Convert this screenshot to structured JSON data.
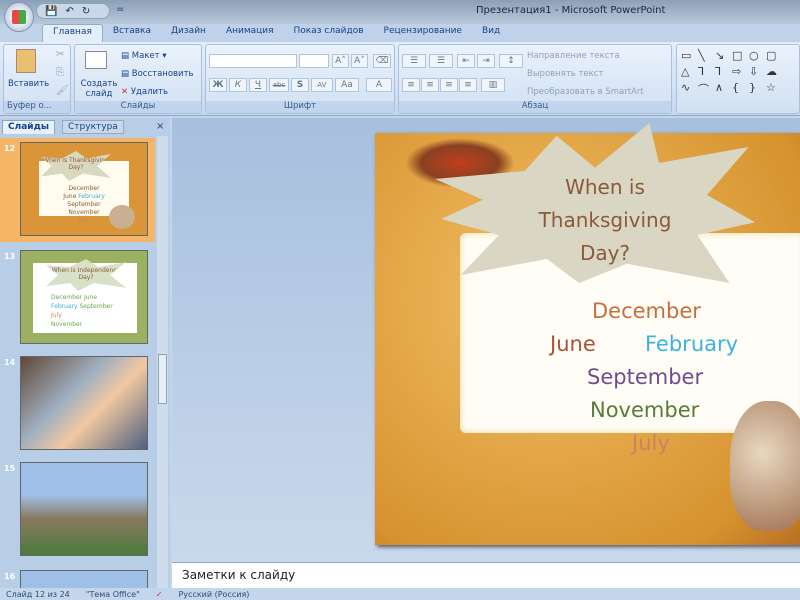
{
  "window": {
    "title": "Презентация1 - Microsoft PowerPoint"
  },
  "qat": {
    "save": "💾",
    "undo": "↶",
    "redo": "↻",
    "more": "="
  },
  "tabs": [
    "Главная",
    "Вставка",
    "Дизайн",
    "Анимация",
    "Показ слайдов",
    "Рецензирование",
    "Вид"
  ],
  "ribbon": {
    "clipboard": {
      "paste": "Вставить",
      "label": "Буфер о..."
    },
    "slides": {
      "new_slide": "Создать слайд",
      "layout": "Макет",
      "reset": "Восстановить",
      "delete": "Удалить",
      "label": "Слайды"
    },
    "font": {
      "bold": "Ж",
      "italic": "К",
      "underline": "Ч",
      "strike": "abc",
      "shadow": "S",
      "spacing": "AV",
      "case": "Aa",
      "color": "A",
      "grow": "A˄",
      "shrink": "A˅",
      "label": "Шрифт"
    },
    "paragraph": {
      "text_direction": "Направление текста",
      "align_text": "Выровнять текст",
      "smartart": "Преобразовать в SmartArt",
      "label": "Абзац"
    },
    "shapes": [
      "▭",
      "╲",
      "↘",
      "□",
      "○",
      "▢",
      "△",
      "⅂",
      "⅂",
      "⇨",
      "⇩",
      "☁",
      "∿",
      "⌒",
      "∧",
      "{",
      "}",
      "☆"
    ]
  },
  "left_panel": {
    "tabs": [
      "Слайды",
      "Структура"
    ],
    "close": "×",
    "slides": [
      {
        "num": "12",
        "title": "When is Thanksgiving Day?",
        "selected": true
      },
      {
        "num": "13",
        "title": "When is Independence Day?"
      },
      {
        "num": "14"
      },
      {
        "num": "15"
      },
      {
        "num": "16"
      }
    ]
  },
  "slide": {
    "title": [
      "When is",
      "Thanksgiving",
      "Day?"
    ],
    "options": [
      {
        "text": "December",
        "color": "#c4703a"
      },
      {
        "text": "June",
        "color": "#a8523a"
      },
      {
        "text": "February",
        "color": "#3ab4dc"
      },
      {
        "text": "September",
        "color": "#6e4c8e"
      },
      {
        "text": "November",
        "color": "#5a7a3a"
      },
      {
        "text": "July",
        "color": "#d08060"
      }
    ]
  },
  "notes": {
    "placeholder": "Заметки к слайду"
  },
  "status": {
    "slide": "Слайд 12 из 24",
    "theme": "\"Тема Office\"",
    "language": "Русский (Россия)"
  }
}
